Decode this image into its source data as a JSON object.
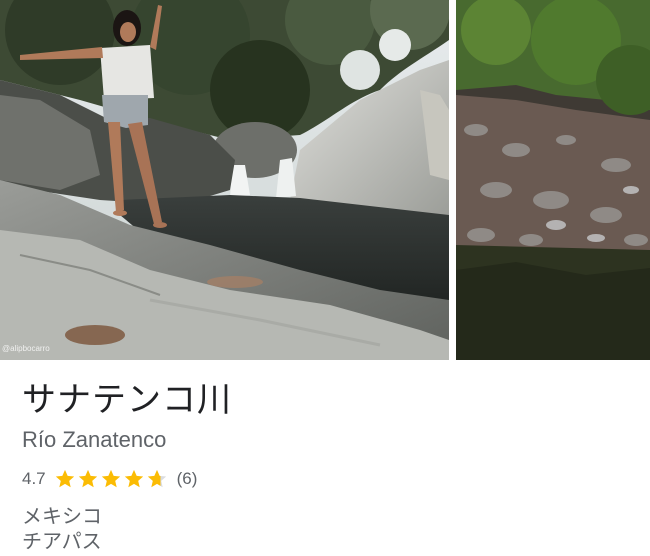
{
  "place": {
    "name": "サナテンコ川",
    "native_name": "Río Zanatenco",
    "rating": "4.7",
    "rating_value": 4.7,
    "star_max": 5,
    "review_count": "(6)",
    "address_line1": "メキシコ",
    "address_line2": "チアパス"
  },
  "photos": {
    "main_alt": "Woman standing on rocks beside a river pool with a waterfall",
    "side_alt": "Rocky dry riverbed with green vegetation",
    "credit": "@alipbocarro"
  },
  "colors": {
    "star": "#fbbc04",
    "star_empty": "#dadce0",
    "title": "#202124",
    "secondary": "#5f6368"
  }
}
